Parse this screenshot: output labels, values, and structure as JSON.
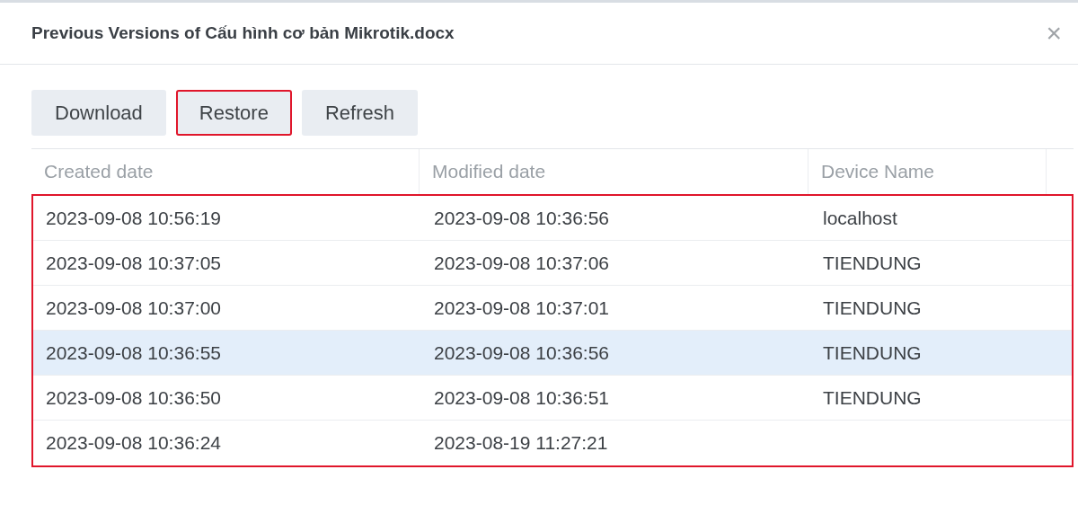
{
  "dialog": {
    "title": "Previous Versions of Cấu hình cơ bản Mikrotik.docx",
    "close": "×"
  },
  "toolbar": [
    {
      "label": "Download",
      "highlighted": false
    },
    {
      "label": "Restore",
      "highlighted": true
    },
    {
      "label": "Refresh",
      "highlighted": false
    }
  ],
  "table": {
    "highlighted": true,
    "columns": [
      "Created date",
      "Modified date",
      "Device Name"
    ],
    "rows": [
      {
        "cells": [
          "2023-09-08 10:56:19",
          "2023-09-08 10:36:56",
          "localhost"
        ],
        "selected": false
      },
      {
        "cells": [
          "2023-09-08 10:37:05",
          "2023-09-08 10:37:06",
          "TIENDUNG"
        ],
        "selected": false
      },
      {
        "cells": [
          "2023-09-08 10:37:00",
          "2023-09-08 10:37:01",
          "TIENDUNG"
        ],
        "selected": false
      },
      {
        "cells": [
          "2023-09-08 10:36:55",
          "2023-09-08 10:36:56",
          "TIENDUNG"
        ],
        "selected": true
      },
      {
        "cells": [
          "2023-09-08 10:36:50",
          "2023-09-08 10:36:51",
          "TIENDUNG"
        ],
        "selected": false
      },
      {
        "cells": [
          "2023-09-08 10:36:24",
          "2023-08-19 11:27:21",
          ""
        ],
        "selected": false
      }
    ]
  }
}
